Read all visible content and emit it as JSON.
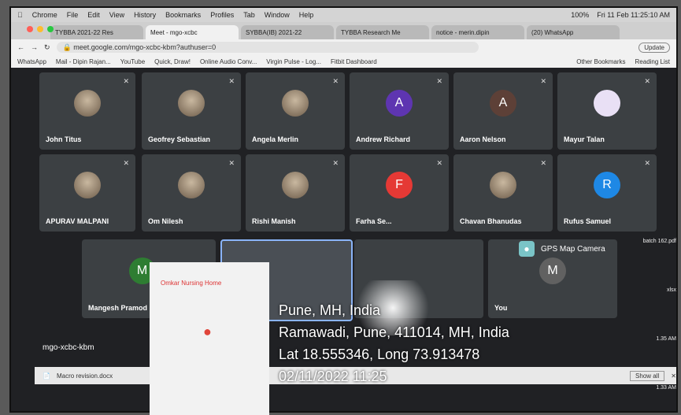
{
  "menubar": {
    "items": [
      "Chrome",
      "File",
      "Edit",
      "View",
      "History",
      "Bookmarks",
      "Profiles",
      "Tab",
      "Window",
      "Help"
    ],
    "clock": "Fri 11 Feb 11:25:10 AM",
    "battery": "100%"
  },
  "tabs": [
    "TYBBA 2021-22 Res",
    "Meet - mgo-xcbc",
    "SYBBA(IB) 2021-22",
    "TYBBA Research Me",
    "notice - merin.dipin",
    "(20) WhatsApp"
  ],
  "address": {
    "url": "meet.google.com/mgo-xcbc-kbm?authuser=0",
    "update_label": "Update"
  },
  "bookmarks": [
    "WhatsApp",
    "Mail - Dipin Rajan...",
    "YouTube",
    "Quick, Draw!",
    "Online Audio Conv...",
    "Virgin Pulse - Log...",
    "Fitbit Dashboard",
    "Other Bookmarks",
    "Reading List"
  ],
  "participants": [
    {
      "name": "John Titus",
      "initial": "",
      "color": ""
    },
    {
      "name": "Geofrey Sebastian",
      "initial": "",
      "color": ""
    },
    {
      "name": "Angela Merlin",
      "initial": "",
      "color": ""
    },
    {
      "name": "Andrew Richard",
      "initial": "A",
      "color": "#5e35b1"
    },
    {
      "name": "Aaron Nelson",
      "initial": "A",
      "color": "#5d4037"
    },
    {
      "name": "Mayur Talan",
      "initial": "",
      "color": ""
    },
    {
      "name": "APURAV MALPANI",
      "initial": "",
      "color": ""
    },
    {
      "name": "Om Nilesh",
      "initial": "",
      "color": ""
    },
    {
      "name": "Rishi Manish",
      "initial": "",
      "color": ""
    },
    {
      "name": "Farha Se...",
      "initial": "F",
      "color": "#e53935"
    },
    {
      "name": "Chavan Bhanudas",
      "initial": "",
      "color": ""
    },
    {
      "name": "Rufus Samuel",
      "initial": "R",
      "color": "#1e88e5"
    },
    {
      "name": "Mangesh Pramod",
      "initial": "M",
      "color": "#2e7d32"
    },
    {
      "name": "You",
      "initial": "M",
      "color": "#616161"
    }
  ],
  "gps_label": "GPS Map Camera",
  "meeting_code": "mgo-xcbc-kbm",
  "download_file": "Macro revision.docx",
  "show_all": "Show all",
  "map_place": "Omkar Nursing Home",
  "overlay": {
    "line1": "Pune, MH, India",
    "line2": "Ramawadi, Pune, 411014, MH, India",
    "line3": "Lat 18.555346, Long 73.913478",
    "line4": "02/11/2022 11:25"
  },
  "side_files": [
    "batch 162.pdf",
    "xlsx",
    "1.35 AM",
    "1.33 AM",
    "1.35 AM",
    "s.pdf"
  ]
}
